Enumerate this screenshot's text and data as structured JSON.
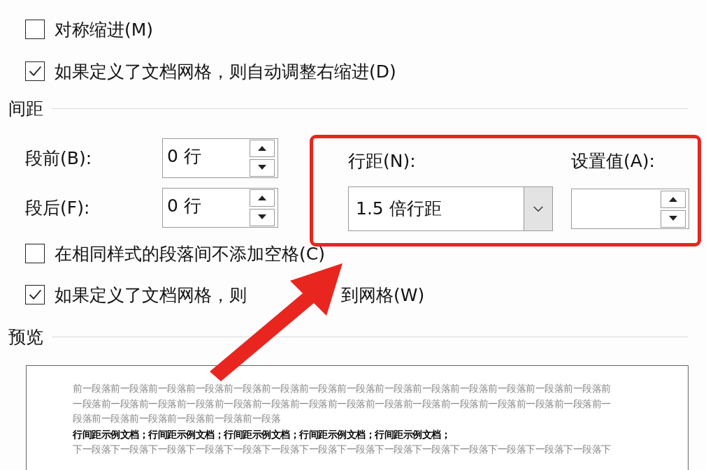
{
  "indent_options": [
    {
      "label": "对称缩进(M)",
      "checked": false
    },
    {
      "label": "如果定义了文档网格，则自动调整右缩进(D)",
      "checked": true
    }
  ],
  "spacing": {
    "title": "间距",
    "fields": [
      {
        "label": "段前(B):",
        "value": "0 行"
      },
      {
        "label": "段后(F):",
        "value": "0 行"
      }
    ],
    "line_spacing": {
      "label": "行距(N):",
      "value": "1.5 倍行距"
    },
    "setting": {
      "label": "设置值(A):"
    }
  },
  "spacing_options": [
    {
      "label": "在相同样式的段落间不添加空格(C)",
      "checked": false
    },
    {
      "label_before_arrow": "如果定义了文档网格，则",
      "label_after_arrow": "到网格(W)",
      "checked": true
    }
  ],
  "preview": {
    "title": "预览",
    "lines": [
      {
        "kind": "previous",
        "text": "前一段落前一段落前一段落前一段落前一段落前一段落前一段落前一段落前一段落前一段落前一段落前一段落前一段落前一段落前"
      },
      {
        "kind": "previous",
        "text": "一段落前一段落前一段落前一段落前一段落前一段落前一段落前一段落前一段落前一段落前一段落前一段落前一段落前一段落前一"
      },
      {
        "kind": "previous",
        "text": "段落前一段落前一段落前一段落前一段落前一段落"
      },
      {
        "kind": "sample",
        "text": "行间距示例文档；行间距示例文档；行间距示例文档；行间距示例文档；行间距示例文档；"
      },
      {
        "kind": "next",
        "text": "下一段落下一段落下一段落下一段落下一段落下一段落下一段落下一段落下一段落下一段落下一段落下一段落下一段落下一段落下"
      }
    ]
  }
}
